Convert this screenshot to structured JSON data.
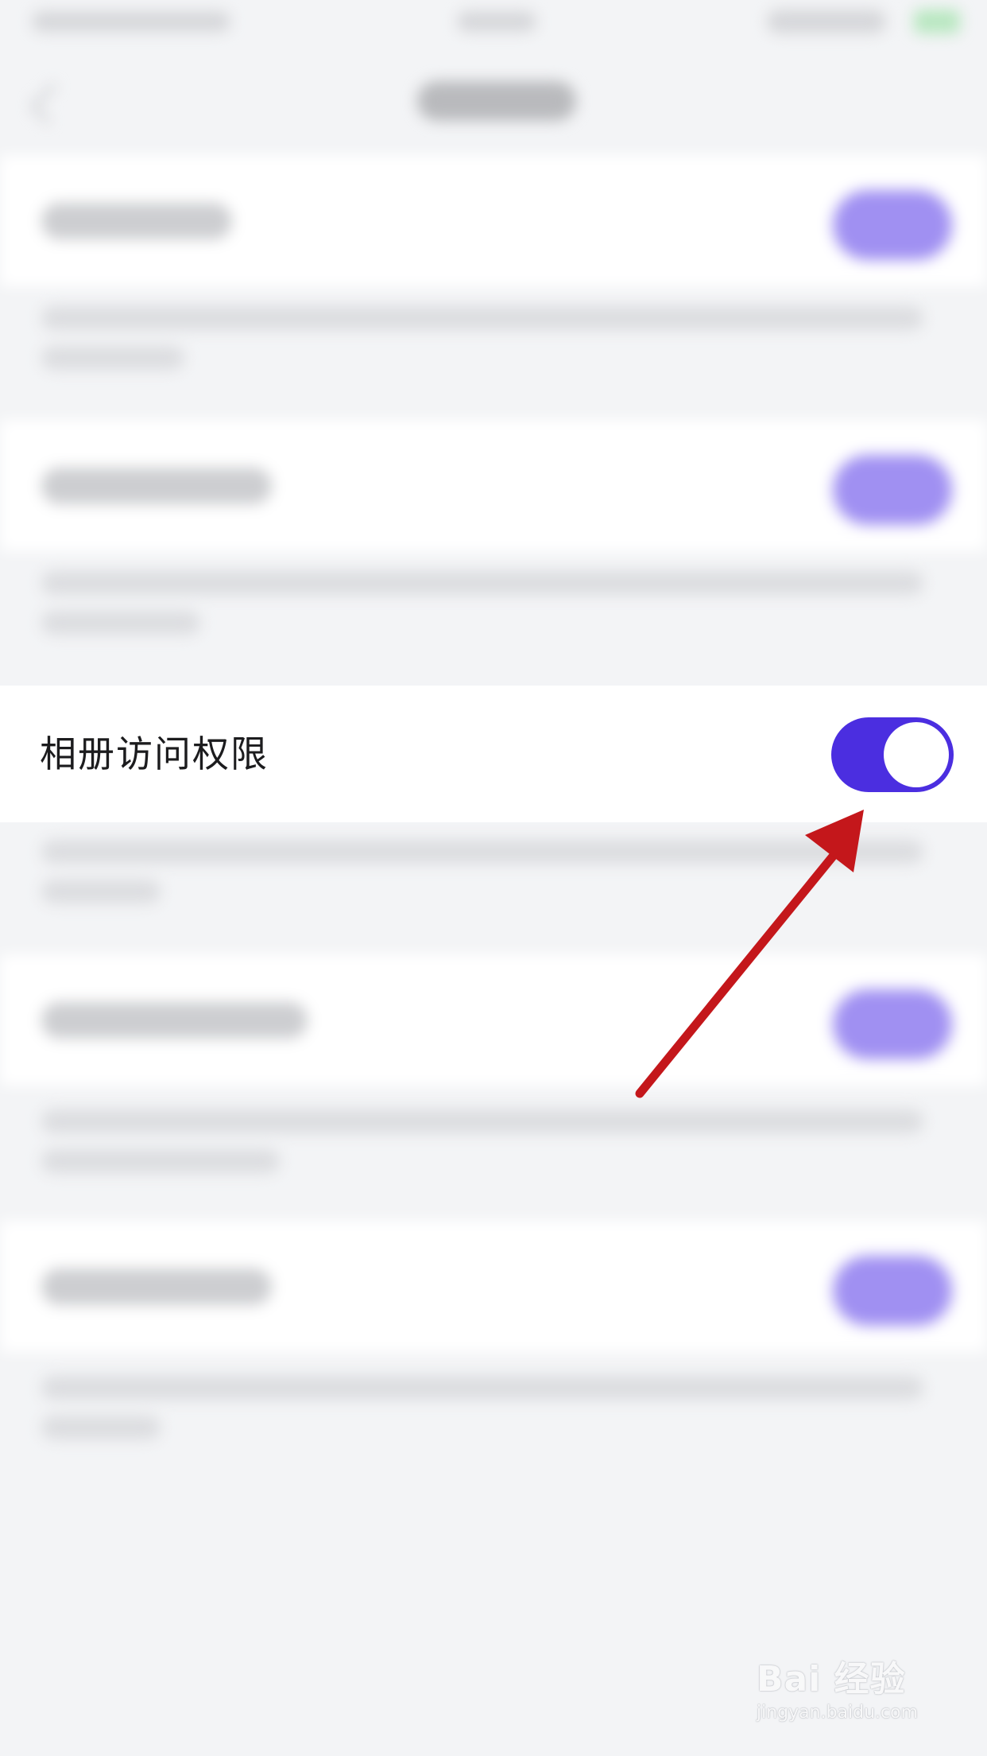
{
  "setting": {
    "label": "相册访问权限",
    "toggle_on": true,
    "toggle_color": "#4b2ee0"
  },
  "annotation": {
    "arrow_color": "#c4171b"
  },
  "watermark": {
    "logo": "Bai 经验",
    "url": "jingyan.baidu.com"
  }
}
